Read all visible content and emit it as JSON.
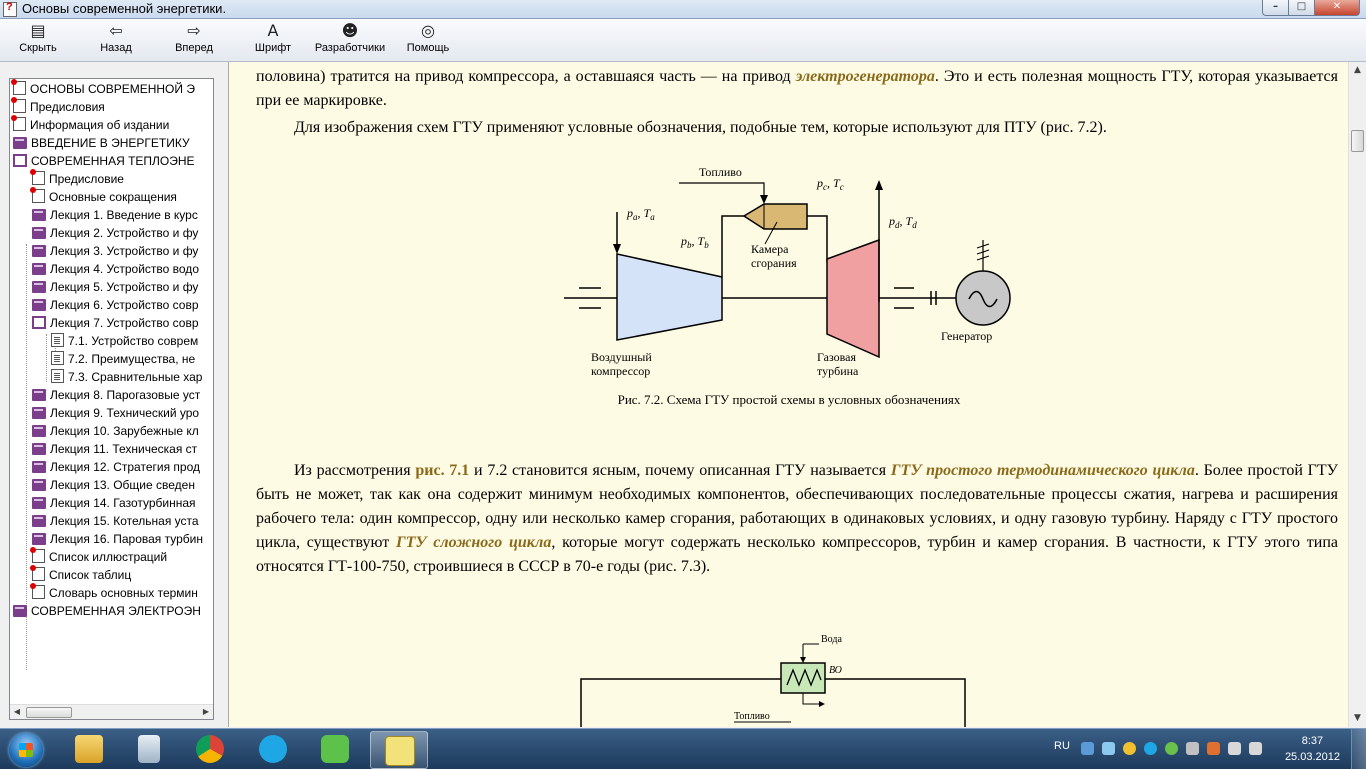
{
  "window": {
    "title": "Основы современной энергетики."
  },
  "toolbar": {
    "buttons": [
      {
        "label": "Скрыть",
        "icon": "hide-icon"
      },
      {
        "label": "Назад",
        "icon": "back-arrow-icon"
      },
      {
        "label": "Вперед",
        "icon": "forward-arrow-icon"
      },
      {
        "label": "Шрифт",
        "icon": "font-icon"
      },
      {
        "label": "Разработчики",
        "icon": "developers-icon"
      },
      {
        "label": "Помощь",
        "icon": "help-icon"
      }
    ]
  },
  "tree": {
    "items": [
      {
        "label": "ОСНОВЫ СОВРЕМЕННОЙ Э",
        "icon": "special-page-icon"
      },
      {
        "label": "Предисловия",
        "icon": "special-page-icon"
      },
      {
        "label": "Информация об издании",
        "icon": "special-page-icon"
      },
      {
        "label": "ВВЕДЕНИЕ В ЭНЕРГЕТИКУ",
        "icon": "book-icon"
      },
      {
        "label": "СОВРЕМЕННАЯ ТЕПЛОЭНЕ",
        "icon": "open-book-icon"
      },
      {
        "label": "Предисловие",
        "icon": "special-page-icon"
      },
      {
        "label": "Основные сокращения",
        "icon": "special-page-icon"
      },
      {
        "label": "Лекция 1. Введение в курс",
        "icon": "book-icon"
      },
      {
        "label": "Лекция 2. Устройство и фу",
        "icon": "book-icon"
      },
      {
        "label": "Лекция 3. Устройство и фу",
        "icon": "book-icon"
      },
      {
        "label": "Лекция 4. Устройство водо",
        "icon": "book-icon"
      },
      {
        "label": "Лекция 5. Устройство и фу",
        "icon": "book-icon"
      },
      {
        "label": "Лекция 6. Устройство совр",
        "icon": "book-icon"
      },
      {
        "label": "Лекция 7. Устройство совр",
        "icon": "open-book-icon"
      },
      {
        "label": "7.1. Устройство соврем",
        "icon": "page-icon"
      },
      {
        "label": "7.2. Преимущества, не",
        "icon": "page-icon"
      },
      {
        "label": "7.3. Сравнительные хар",
        "icon": "page-icon"
      },
      {
        "label": "Лекция 8. Парогазовые уст",
        "icon": "book-icon"
      },
      {
        "label": "Лекция 9. Технический уро",
        "icon": "book-icon"
      },
      {
        "label": "Лекция 10. Зарубежные кл",
        "icon": "book-icon"
      },
      {
        "label": "Лекция 11. Техническая ст",
        "icon": "book-icon"
      },
      {
        "label": "Лекция 12. Стратегия прод",
        "icon": "book-icon"
      },
      {
        "label": "Лекция 13. Общие сведен",
        "icon": "book-icon"
      },
      {
        "label": "Лекция 14. Газотурбинная",
        "icon": "book-icon"
      },
      {
        "label": "Лекция 15. Котельная уста",
        "icon": "book-icon"
      },
      {
        "label": "Лекция 16. Паровая турбин",
        "icon": "book-icon"
      },
      {
        "label": "Список иллюстраций",
        "icon": "special-page-icon"
      },
      {
        "label": "Список таблиц",
        "icon": "special-page-icon"
      },
      {
        "label": "Словарь основных термин",
        "icon": "special-page-icon"
      },
      {
        "label": "СОВРЕМЕННАЯ ЭЛЕКТРОЭН",
        "icon": "book-icon"
      }
    ]
  },
  "content": {
    "p1_a": "половина) тратится на привод компрессора, а оставшаяся часть — на привод ",
    "p1_link": "электрогенератора",
    "p1_b": ". Это и есть полезная мощность ГТУ, которая указывается при ее маркировке.",
    "p2": "Для изображения схем ГТУ применяют условные обозначения, подобные тем, которые используют для ПТУ (рис. 7.2).",
    "fig72": {
      "fuel": "Топливо",
      "pa": "p",
      "pa_sub": "a",
      "ta": "T",
      "ta_sub": "a",
      "pb": "p",
      "pb_sub": "b",
      "tb": "T",
      "tb_sub": "b",
      "pc": "p",
      "pc_sub": "c",
      "tc": "T",
      "tc_sub": "c",
      "pd": "p",
      "pd_sub": "d",
      "td": "T",
      "td_sub": "d",
      "chamber1": "Камера",
      "chamber2": "сгорания",
      "comp1": "Воздушный",
      "comp2": "компрессор",
      "turb1": "Газовая",
      "turb2": "турбина",
      "gen": "Генератор"
    },
    "caption": "Рис. 7.2. Схема ГТУ простой схемы в условных обозначениях",
    "p3_a": "Из рассмотрения ",
    "p3_ref": "рис. 7.1",
    "p3_b": " и 7.2 становится ясным, почему описанная ГТУ называется ",
    "p3_link1": "ГТУ простого термодинамического цикла",
    "p3_c": ". Более простой ГТУ быть не может, так как она содержит минимум необходимых компонентов, обеспечивающих последовательные процессы сжатия, нагрева и расширения рабочего тела: один компрессор, одну или несколько камер сгорания, работающих в одинаковых условиях, и одну газовую турбину. Наряду с ГТУ простого цикла, существуют ",
    "p3_link2": "ГТУ сложного цикла",
    "p3_d": ", которые могут содержать несколько компрессоров, турбин и камер сгорания. В частности, к ГТУ этого типа относятся ГТ-100-750, строившиеся в СССР в 70-е годы (рис. 7.3).",
    "fig73": {
      "water": "Вода",
      "vo": "ВО",
      "fuel": "Топливо"
    }
  },
  "taskbar": {
    "lang": "RU",
    "time": "8:37",
    "date": "25.03.2012"
  },
  "colors": {
    "link": "#8a6a1a",
    "content_bg": "#fdfbe3",
    "compressor": "#d4e3f8",
    "turbine": "#f0a0a0",
    "chamber": "#d9b874"
  }
}
